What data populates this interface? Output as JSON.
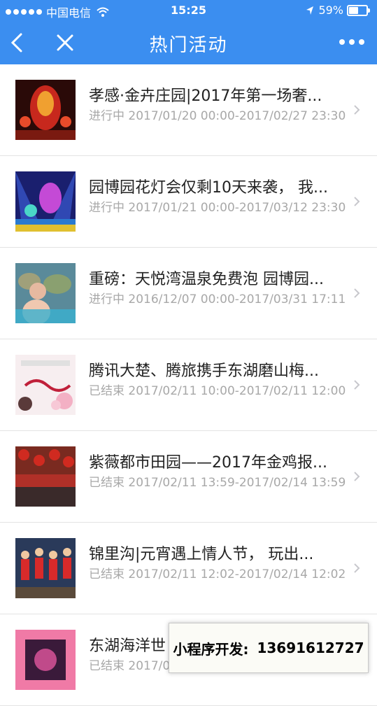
{
  "status_bar": {
    "carrier": "中国电信",
    "time": "15:25",
    "battery": "59%",
    "battery_level": 0.59
  },
  "nav": {
    "title": "热门活动",
    "back_icon": "chevron-left-icon",
    "close_icon": "close-icon",
    "more_icon": "more-dots-icon"
  },
  "items": [
    {
      "title": "孝感·金卉庄园|2017年第一场奢...",
      "status": "进行中",
      "time": "2017/01/20 00:00-2017/02/27 23:30"
    },
    {
      "title": "园博园花灯会仅剩10天来袭， 我...",
      "status": "进行中",
      "time": "2017/01/21 00:00-2017/03/12 23:30"
    },
    {
      "title": "重磅：天悦湾温泉免费泡 园博园...",
      "status": "进行中",
      "time": "2016/12/07 00:00-2017/03/31 17:11"
    },
    {
      "title": "腾讯大楚、腾旅携手东湖磨山梅...",
      "status": "已结束",
      "time": "2017/02/11 10:00-2017/02/11 12:00"
    },
    {
      "title": "紫薇都市田园——2017年金鸡报...",
      "status": "已结束",
      "time": "2017/02/11 13:59-2017/02/14 13:59"
    },
    {
      "title": "锦里沟|元宵遇上情人节， 玩出...",
      "status": "已结束",
      "time": "2017/02/11 12:02-2017/02/14 12:02"
    },
    {
      "title": "东湖海洋世",
      "status": "已结束",
      "time": "2017/0"
    }
  ],
  "watermark": {
    "label": "小程序开发:",
    "phone": "13691612727"
  },
  "colors": {
    "header": "#3b8ef0",
    "title_text": "#222222",
    "sub_text": "#a8a8a8"
  }
}
